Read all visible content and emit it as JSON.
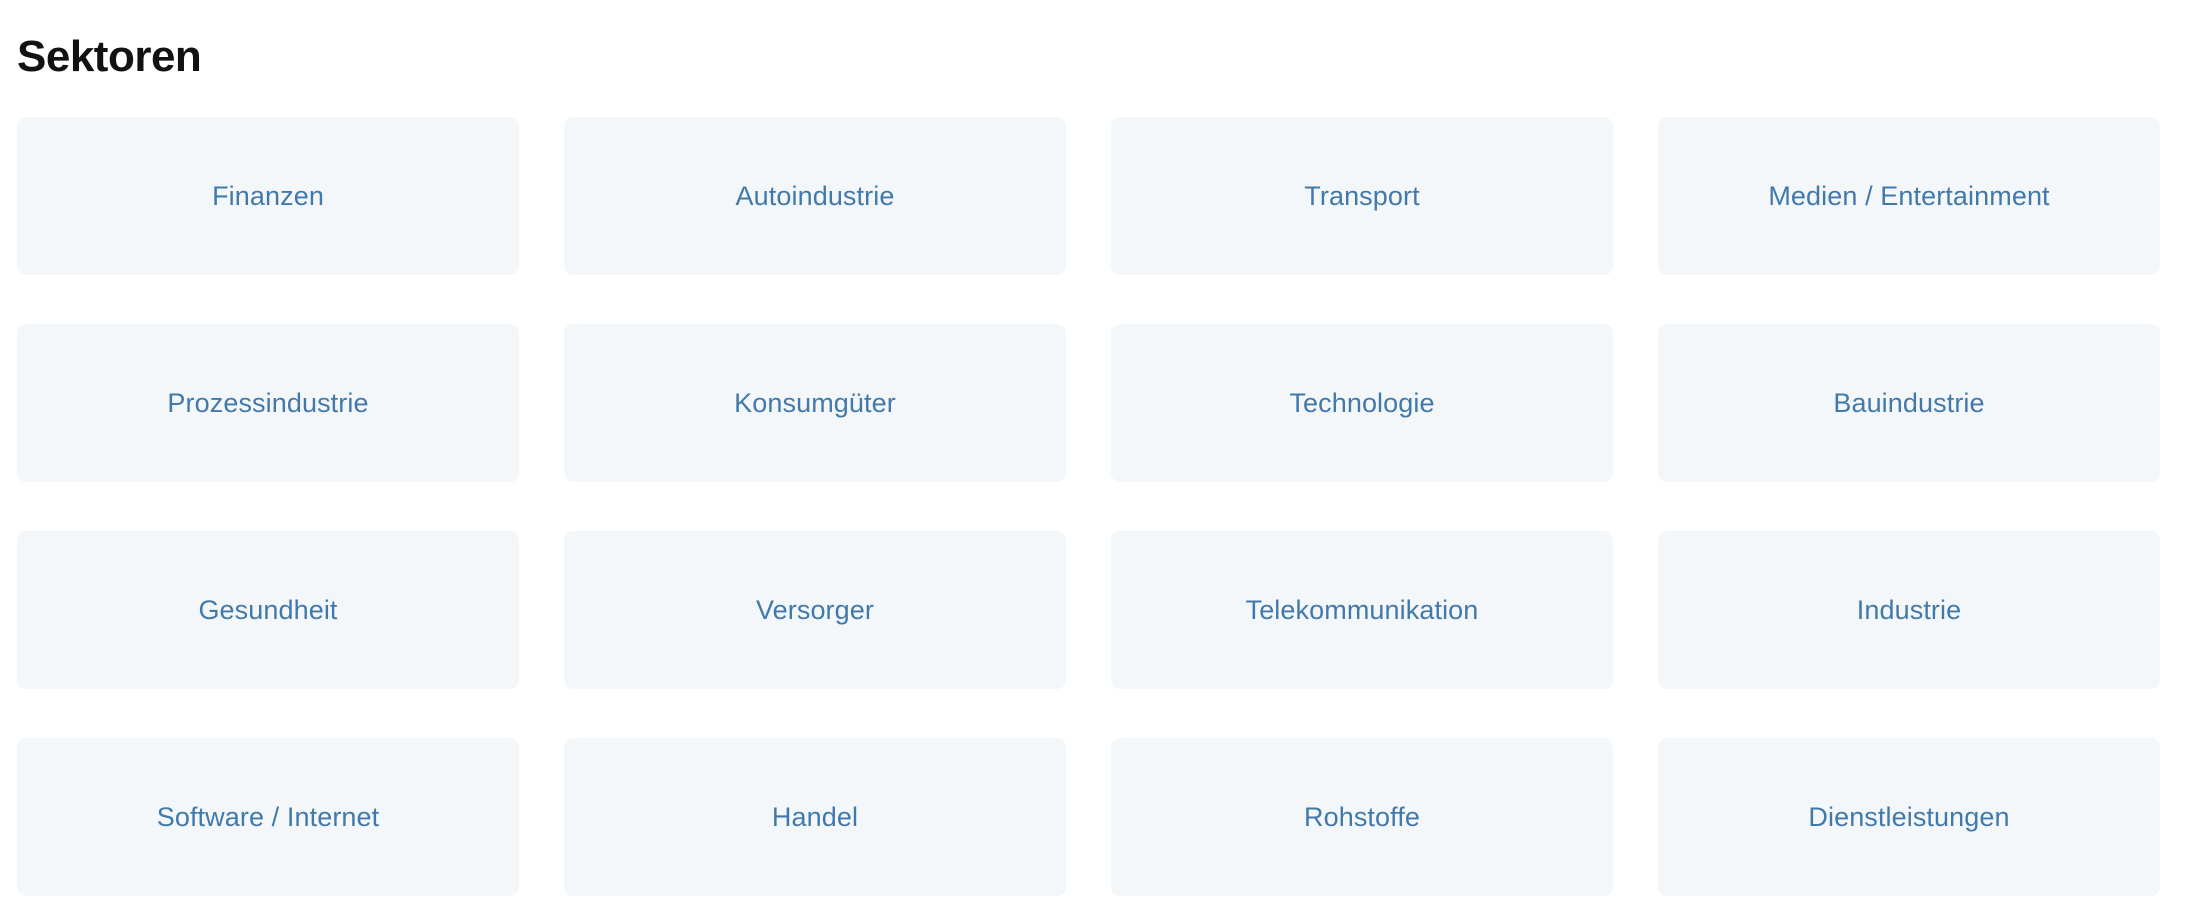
{
  "page": {
    "title": "Sektoren",
    "background_color": "#ffffff",
    "title_color": "#101214"
  },
  "theme": {
    "card_background": "#f4f7fa",
    "card_label_color": "#4279ab",
    "card_radius_px": 9
  },
  "sectors": {
    "columns": 4,
    "items": [
      {
        "label": "Finanzen"
      },
      {
        "label": "Autoindustrie"
      },
      {
        "label": "Transport"
      },
      {
        "label": "Medien / Entertainment"
      },
      {
        "label": "Prozessindustrie"
      },
      {
        "label": "Konsumgüter"
      },
      {
        "label": "Technologie"
      },
      {
        "label": "Bauindustrie"
      },
      {
        "label": "Gesundheit"
      },
      {
        "label": "Versorger"
      },
      {
        "label": "Telekommunikation"
      },
      {
        "label": "Industrie"
      },
      {
        "label": "Software / Internet"
      },
      {
        "label": "Handel"
      },
      {
        "label": "Rohstoffe"
      },
      {
        "label": "Dienstleistungen"
      }
    ]
  }
}
